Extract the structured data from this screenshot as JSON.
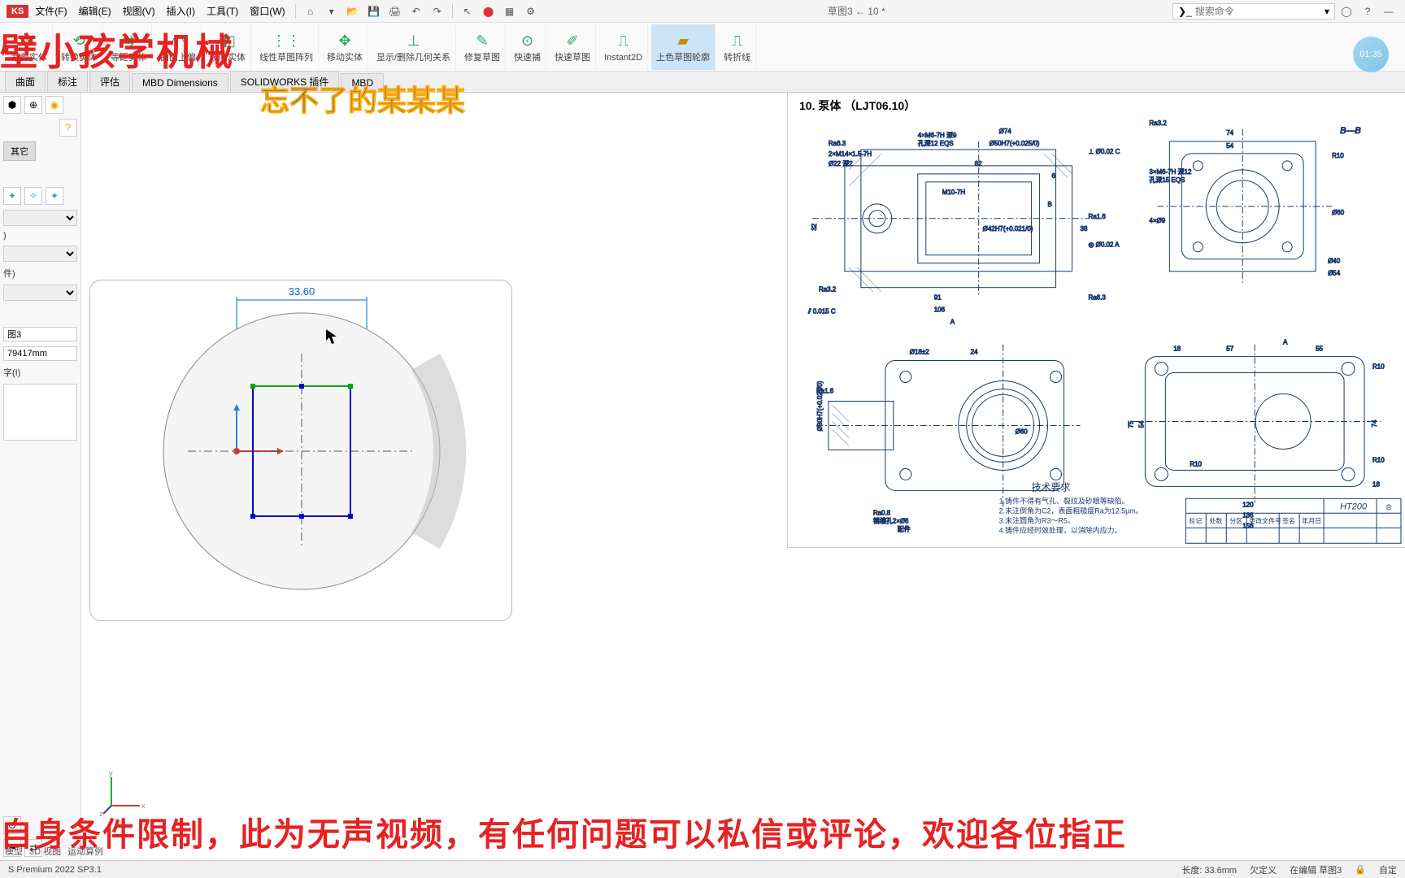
{
  "app": {
    "logo": "KS",
    "docname": "草图3 ← 10 *"
  },
  "menu": {
    "file": "文件(F)",
    "edit": "编辑(E)",
    "view": "视图(V)",
    "insert": "插入(I)",
    "tool": "工具(T)",
    "window": "窗口(W)"
  },
  "search": {
    "placeholder": "搜索命令"
  },
  "ribbon": {
    "trim": "裁剪实体",
    "convert": "转换实体",
    "offset": "等距实体",
    "onface": "曲面上偏",
    "mirror": "镜向实体",
    "pattern": "线性草图阵列",
    "move": "移动实体",
    "showrel": "显示/删除几何关系",
    "repair": "修复草图",
    "quick": "快速捕",
    "quicksk": "快速草图",
    "instant2d": "Instant2D",
    "shade": "上色草图轮廓",
    "fold": "转折线"
  },
  "time_badge": "01:35",
  "tabs": {
    "surface": "曲面",
    "annotate": "标注",
    "evaluate": "评估",
    "mbd": "MBD Dimensions",
    "swaddin": "SOLIDWORKS 插件",
    "mbd2": "MBD"
  },
  "sidebar": {
    "othertab": "其它",
    "sketch_name": "图3",
    "dim_value": "79417mm",
    "text_section": "字(I)",
    "condition": ")",
    "jian": "件)"
  },
  "viewport": {
    "dim": "33.60"
  },
  "axis": {
    "x": "x",
    "y": "y",
    "z": "z"
  },
  "drawing": {
    "title": "10. 泵体 （LJT06.10）",
    "req_title": "技术要求",
    "req1": "1.铸件不得有气孔、裂纹及砂眼等缺陷。",
    "req2": "2.未注倒角为C2，表面粗糙度Ra为12.5μm。",
    "req3": "3.未注圆角为R3～R5。",
    "req4": "4.铸件应经时效处理，以消除内应力。",
    "mat": "HT200",
    "labels": {
      "ra63": "Ra6.3",
      "ra32": "Ra3.2",
      "ra16": "Ra1.6",
      "ra08": "Ra0.8",
      "d74": "Ø74",
      "d50": "Ø50H7(+0.025/0)",
      "d42": "Ø42H7(+0.021/0)",
      "d60": "Ø60",
      "d54": "Ø54",
      "d40": "Ø40",
      "d18": "Ø18±2",
      "d30": "Ø30H7(+0.021/0)",
      "m14": "2×M14×1.5-7H",
      "d22": "Ø22 深2",
      "m6": "4×M6-7H 深9",
      "m6b": "3×M6-7H 深12",
      "m10": "M10-7H",
      "eqs12": "孔深12 EQS",
      "eqs15": "孔深15 EQS",
      "d9": "4×Ø9",
      "l62": "62",
      "l6": "6",
      "l32": "32",
      "l91": "91",
      "l106": "106",
      "l18": "18",
      "l57": "57",
      "l55": "55",
      "l10": "R10",
      "l24": "24",
      "l75": "75",
      "l54": "54",
      "l74": "74",
      "l120": "120",
      "l136": "136",
      "l156": "156",
      "bb": "B—B",
      "tol1": "⊥ Ø0.02 C",
      "tol2": "◎ Ø0.02 A",
      "tol3": "⫽ 0.015 C",
      "a": "A",
      "b": "B",
      "c": "C",
      "d38": "38",
      "pin": "销槽孔2×Ø6",
      "peijian": "配件",
      "tb_bz": "标记",
      "tb_cs": "处数",
      "tb_fq": "分区",
      "tb_gg": "更改文件号",
      "tb_qm": "签名",
      "tb_ny": "年月日",
      "he": "合"
    }
  },
  "overlay": {
    "red_tl": "壁小孩学机械",
    "red_bot": "自身条件限制，此为无声视频，有任何问题可以私信或评论，欢迎各位指正",
    "blue": "忘不了的某某某"
  },
  "status": {
    "premium": "S Premium 2022 SP3.1",
    "length": "长度: 33.6mm",
    "under": "欠定义",
    "editing": "在编辑 草图3",
    "custom": "自定"
  },
  "bottab": {
    "model": "模型",
    "view3d": "3D 视图",
    "motion": "运动算例"
  }
}
